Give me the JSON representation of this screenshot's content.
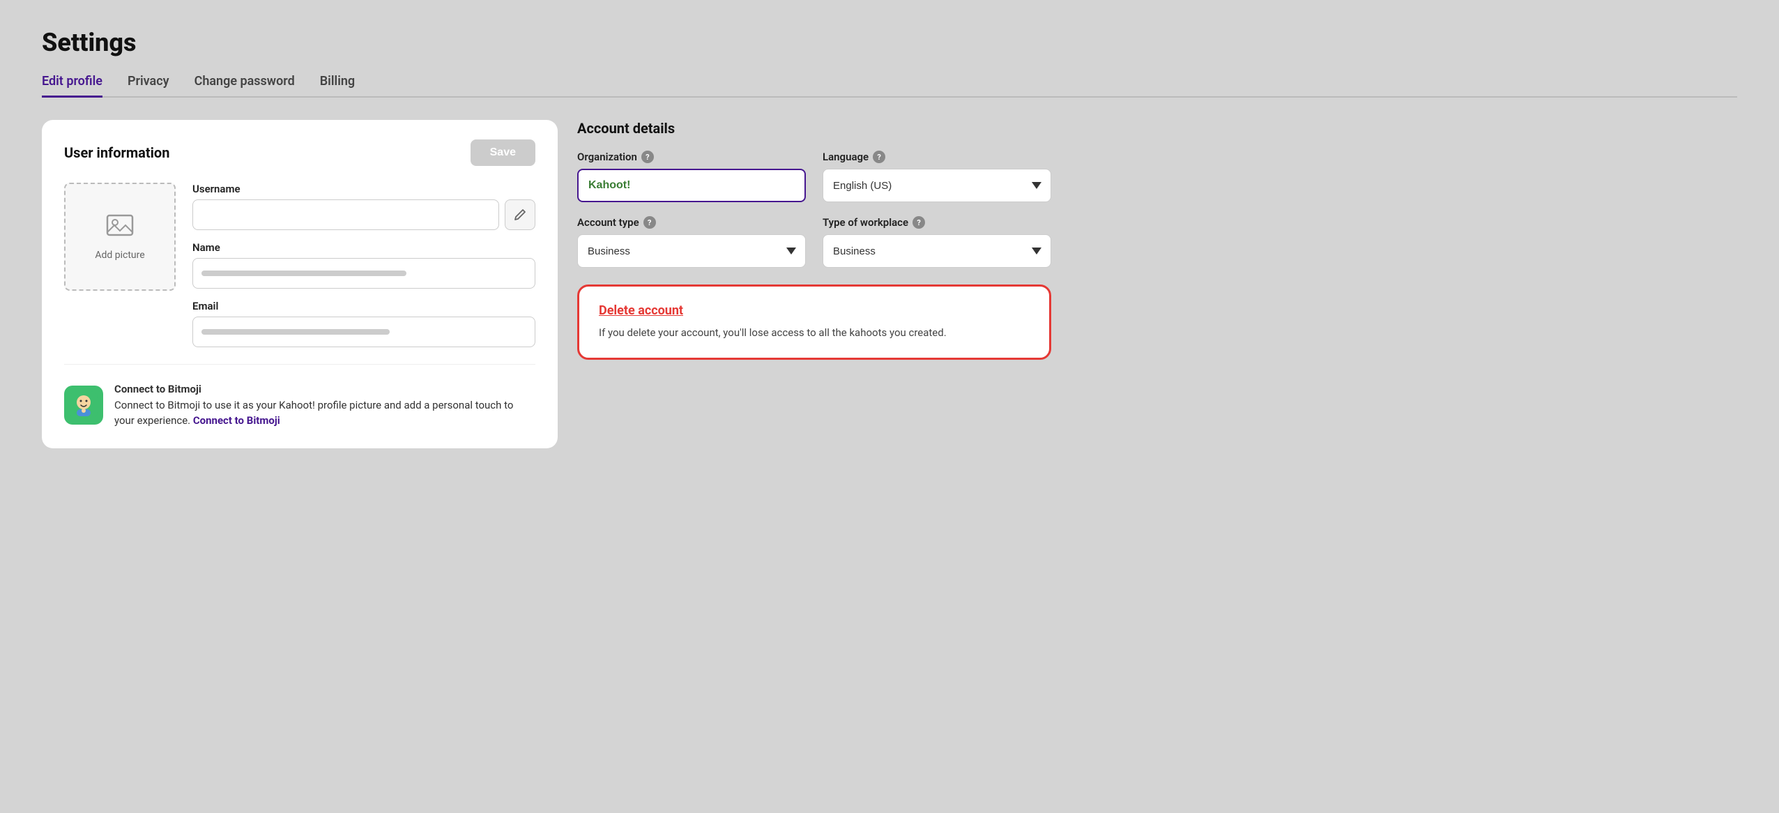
{
  "page": {
    "title": "Settings"
  },
  "tabs": [
    {
      "id": "edit-profile",
      "label": "Edit profile",
      "active": true
    },
    {
      "id": "privacy",
      "label": "Privacy",
      "active": false
    },
    {
      "id": "change-password",
      "label": "Change password",
      "active": false
    },
    {
      "id": "billing",
      "label": "Billing",
      "active": false
    }
  ],
  "left_panel": {
    "title": "User information",
    "save_button": "Save",
    "avatar": {
      "label": "Add picture"
    },
    "fields": {
      "username_label": "Username",
      "name_label": "Name",
      "email_label": "Email"
    },
    "bitmoji_section": {
      "title": "Connect to Bitmoji",
      "description": "Connect to Bitmoji to use it as your Kahoot! profile picture and add a personal touch to your experience.",
      "link_text": "Connect to Bitmoji"
    }
  },
  "right_panel": {
    "title": "Account details",
    "org_label": "Organization",
    "org_value": "Kahoot!",
    "org_placeholder": "Kahoot!",
    "language_label": "Language",
    "language_value": "English (US)",
    "account_type_label": "Account type",
    "account_type_value": "Business",
    "workplace_label": "Type of workplace",
    "workplace_value": "Business",
    "delete_card": {
      "title": "Delete account",
      "description": "If you delete your account, you'll lose access to all the kahoots you created."
    }
  },
  "icons": {
    "image": "🖼",
    "pencil": "✏",
    "chevron_down": "▼",
    "question": "?",
    "bitmoji": "😊"
  }
}
